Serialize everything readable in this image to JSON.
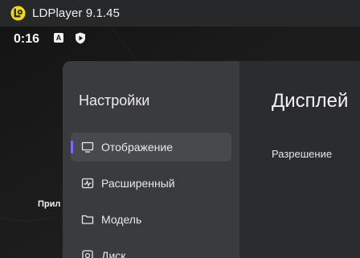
{
  "window": {
    "title": "LDPlayer 9.1.45",
    "logo_icon": "ldplayer-logo-icon",
    "accent_color": "#f5d90a"
  },
  "statusbar": {
    "time": "0:16",
    "icons": [
      "keyboard-a-icon",
      "shield-play-icon"
    ]
  },
  "background": {
    "peek_label": "Прил"
  },
  "settings": {
    "sidebar_title": "Настройки",
    "items": [
      {
        "label": "Отображение",
        "icon": "monitor-icon",
        "active": true
      },
      {
        "label": "Расширенный",
        "icon": "pulse-icon",
        "active": false
      },
      {
        "label": "Модель",
        "icon": "folder-icon",
        "active": false
      },
      {
        "label": "Диск",
        "icon": "disk-icon",
        "active": false
      }
    ],
    "active_indicator_color": "#7b6cff",
    "main_title": "Дисплей",
    "setting_label": "Разрешение"
  }
}
